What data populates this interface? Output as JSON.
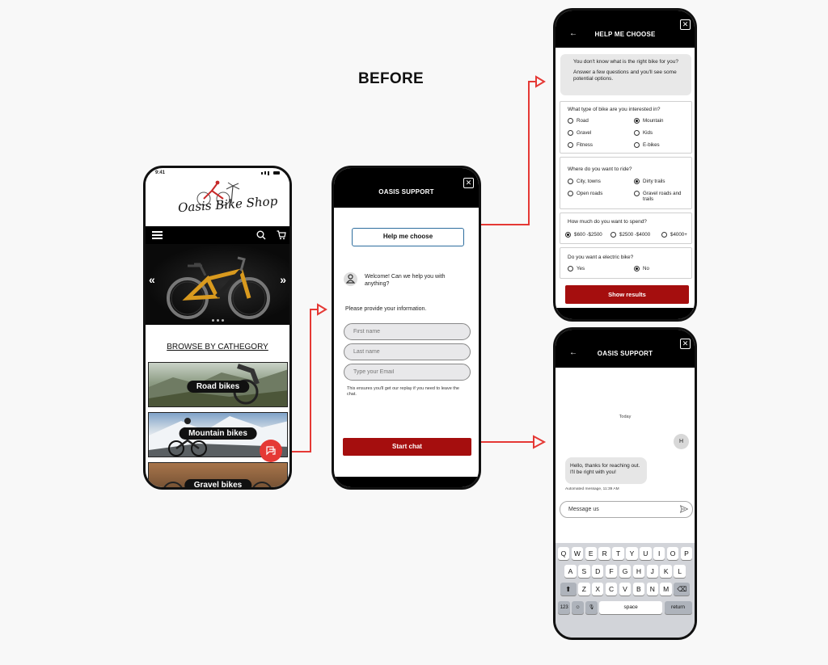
{
  "heading": "BEFORE",
  "colors": {
    "brand_red": "#a50e0e",
    "fab_red": "#e53935",
    "arrow_red": "#e53935",
    "focus_blue": "#2e6e9e"
  },
  "shop": {
    "status_time": "9:41",
    "logo": "Oasis Bike Shop",
    "nav_icons": [
      "menu-icon",
      "search-icon",
      "cart-icon"
    ],
    "carousel_prev": "«",
    "carousel_next": "»",
    "browse_title": "BROWSE BY CATHEGORY",
    "categories": [
      "Road bikes",
      "Mountain bikes",
      "Gravel bikes"
    ]
  },
  "support": {
    "title": "OASIS SUPPORT",
    "close": "✕",
    "help_button": "Help me choose",
    "welcome": "Welcome! Can we help you with anything?",
    "provide": "Please provide your information.",
    "fields": {
      "first_name": "First name",
      "last_name": "Last name",
      "email": "Type your Email"
    },
    "note": "This ensures you'll get our replay if you need to leave the chat.",
    "start_button": "Start chat"
  },
  "chooser": {
    "title": "HELP ME CHOOSE",
    "back": "←",
    "close": "✕",
    "intro_line1": "You don't know what is the right bike for you?",
    "intro_line2": "Answer a few questions and you'll see some potential options.",
    "questions": [
      {
        "q": "What type of bike are you interested in?",
        "options": [
          "Road",
          "Mountain",
          "Gravel",
          "Kids",
          "Fitness",
          "E-bikes"
        ],
        "selected": "Mountain"
      },
      {
        "q": "Where do you want to ride?",
        "options": [
          "City, towns",
          "Dirty trails",
          "Open roads",
          "Gravel roads and trails"
        ],
        "selected": "Dirty trails"
      },
      {
        "q": "How much do you want to spend?",
        "options": [
          "$600 -$2500",
          "$2500 -$4000",
          "$4000+"
        ],
        "selected": "$600 -$2500"
      },
      {
        "q": "Do you want a electric bike?",
        "options": [
          "Yes",
          "No"
        ],
        "selected": "No"
      }
    ],
    "show_button": "Show results"
  },
  "chat": {
    "title": "OASIS SUPPORT",
    "back": "←",
    "close": "✕",
    "today": "Today",
    "user_initial": "H",
    "reply": "Hello, thanks for reaching out. I'll be right with you!",
    "auto_note": "Automated message, 11:39 AM",
    "input_placeholder": "Message us",
    "keyboard": {
      "row1": [
        "Q",
        "W",
        "E",
        "R",
        "T",
        "Y",
        "U",
        "I",
        "O",
        "P"
      ],
      "row2": [
        "A",
        "S",
        "D",
        "F",
        "G",
        "H",
        "J",
        "K",
        "L"
      ],
      "row3": [
        "Z",
        "X",
        "C",
        "V",
        "B",
        "N",
        "M"
      ],
      "shift": "⬆",
      "backspace": "⌫",
      "numbers": "123",
      "emoji": "☺",
      "mic": "🎙",
      "space": "space",
      "return": "return"
    }
  }
}
